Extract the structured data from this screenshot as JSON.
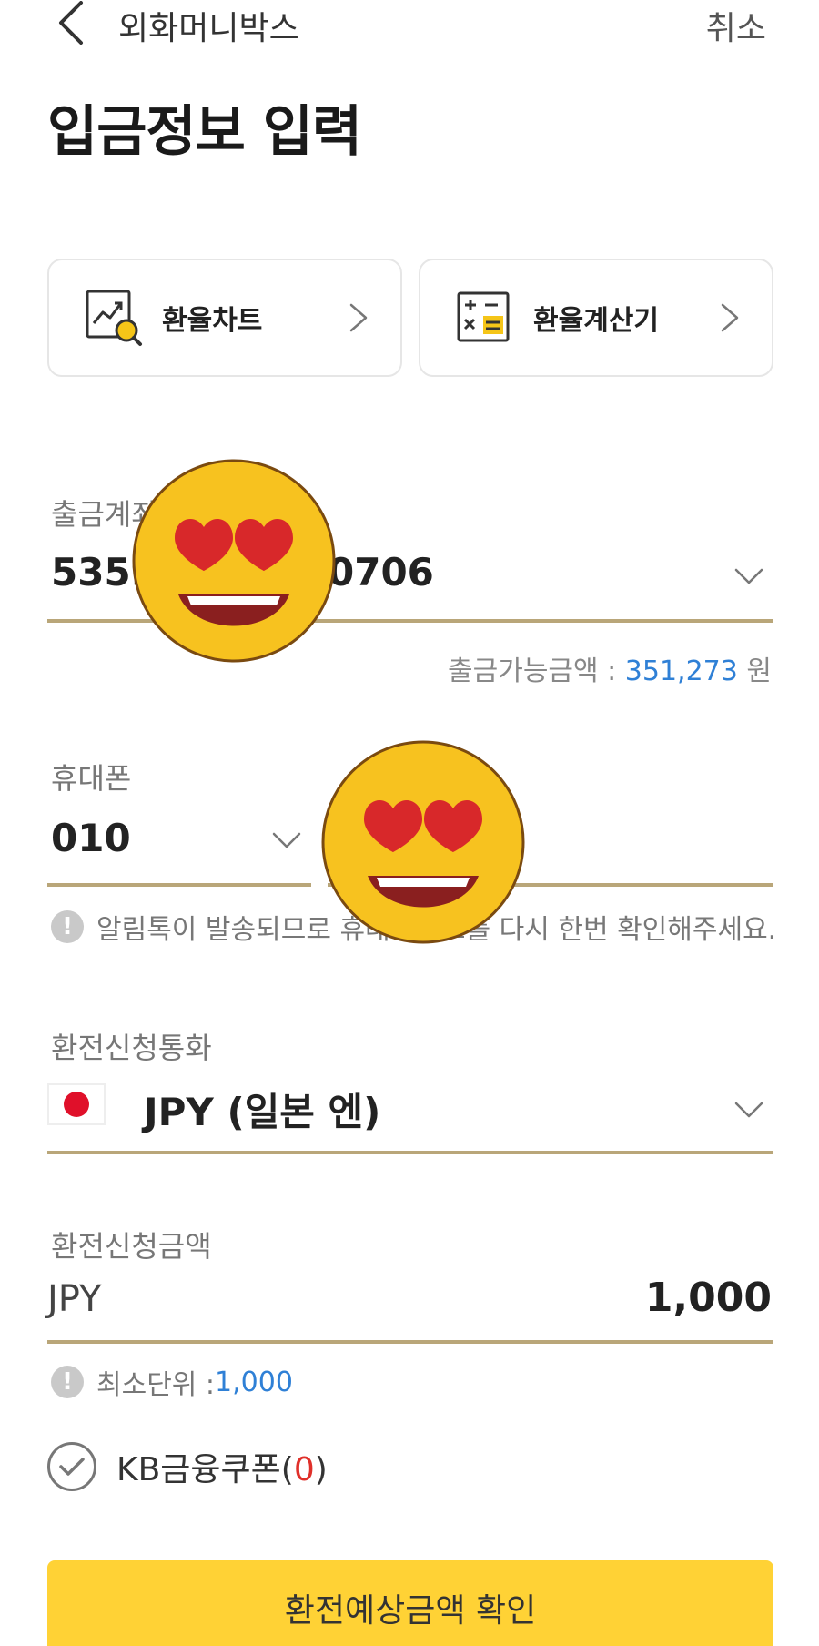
{
  "header": {
    "back_icon": "chevron-left-icon",
    "title": "외화머니박스",
    "cancel_label": "취소"
  },
  "page_title": "입금정보 입력",
  "shortcuts": [
    {
      "label": "환율차트",
      "icon": "chart-search-icon"
    },
    {
      "label": "환율계산기",
      "icon": "calculator-icon"
    }
  ],
  "withdraw_account": {
    "label": "출금계좌",
    "value_prefix": "5359",
    "value_suffix": "0706",
    "available_label": "출금가능금액 : ",
    "available_amount": "351,273",
    "available_unit": " 원"
  },
  "phone": {
    "label": "휴대폰",
    "prefix": "010",
    "notice": "알림톡이 발송되므로 휴대폰번호를 다시 한번 확인해주세요."
  },
  "currency": {
    "label": "환전신청통화",
    "value": "JPY (일본 엔)",
    "flag": "japan-flag"
  },
  "amount": {
    "label": "환전신청금액",
    "currency_code": "JPY",
    "value": "1,000",
    "min_label": "최소단위 : ",
    "min_value": "1,000"
  },
  "coupon": {
    "label_prefix": "KB금융쿠폰(",
    "count": "0",
    "label_suffix": ")"
  },
  "cta_label": "환전예상금액 확인",
  "colors": {
    "accent_yellow": "#ffd235",
    "underline_gold": "#b9a679",
    "link_blue": "#2f80d6",
    "alert_red": "#e0302a"
  }
}
